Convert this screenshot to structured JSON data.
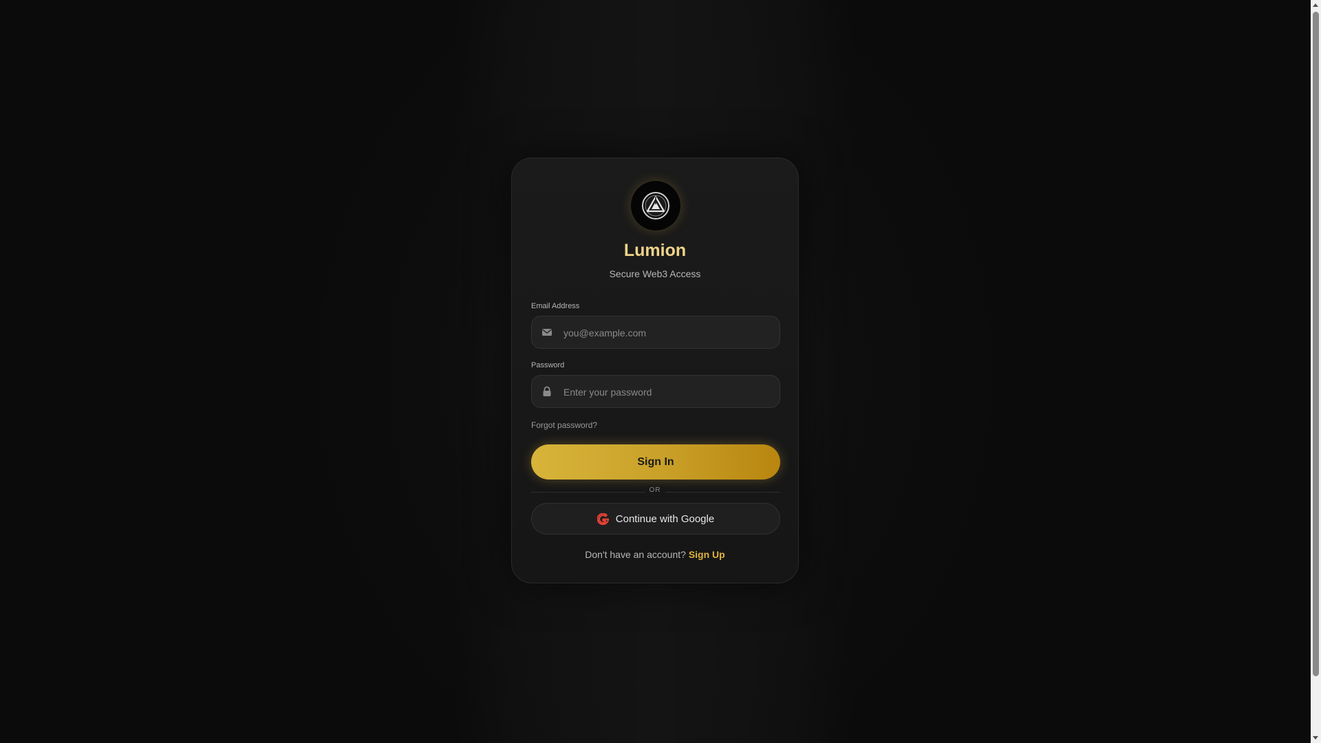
{
  "brand": {
    "title": "Lumion",
    "subtitle": "Secure Web3 Access",
    "logo_icon": "triangle-emblem-icon"
  },
  "form": {
    "email_label": "Email Address",
    "email_placeholder": "you@example.com",
    "email_value": "",
    "email_icon": "envelope-icon",
    "password_label": "Password",
    "password_placeholder": "Enter your password",
    "password_value": "",
    "password_icon": "lock-icon",
    "forgot_label": "Forgot password?",
    "signin_label": "Sign In",
    "divider_label": "OR",
    "google_label": "Continue with Google",
    "google_icon": "google-g-icon"
  },
  "footer": {
    "prompt": "Don't have an account?",
    "signup_label": "Sign Up"
  },
  "colors": {
    "accent": "#d4aa3c",
    "title": "#f0d48a",
    "background": "#0b0b0b",
    "card": "#1a1a1a",
    "google_red": "#ea4335"
  }
}
